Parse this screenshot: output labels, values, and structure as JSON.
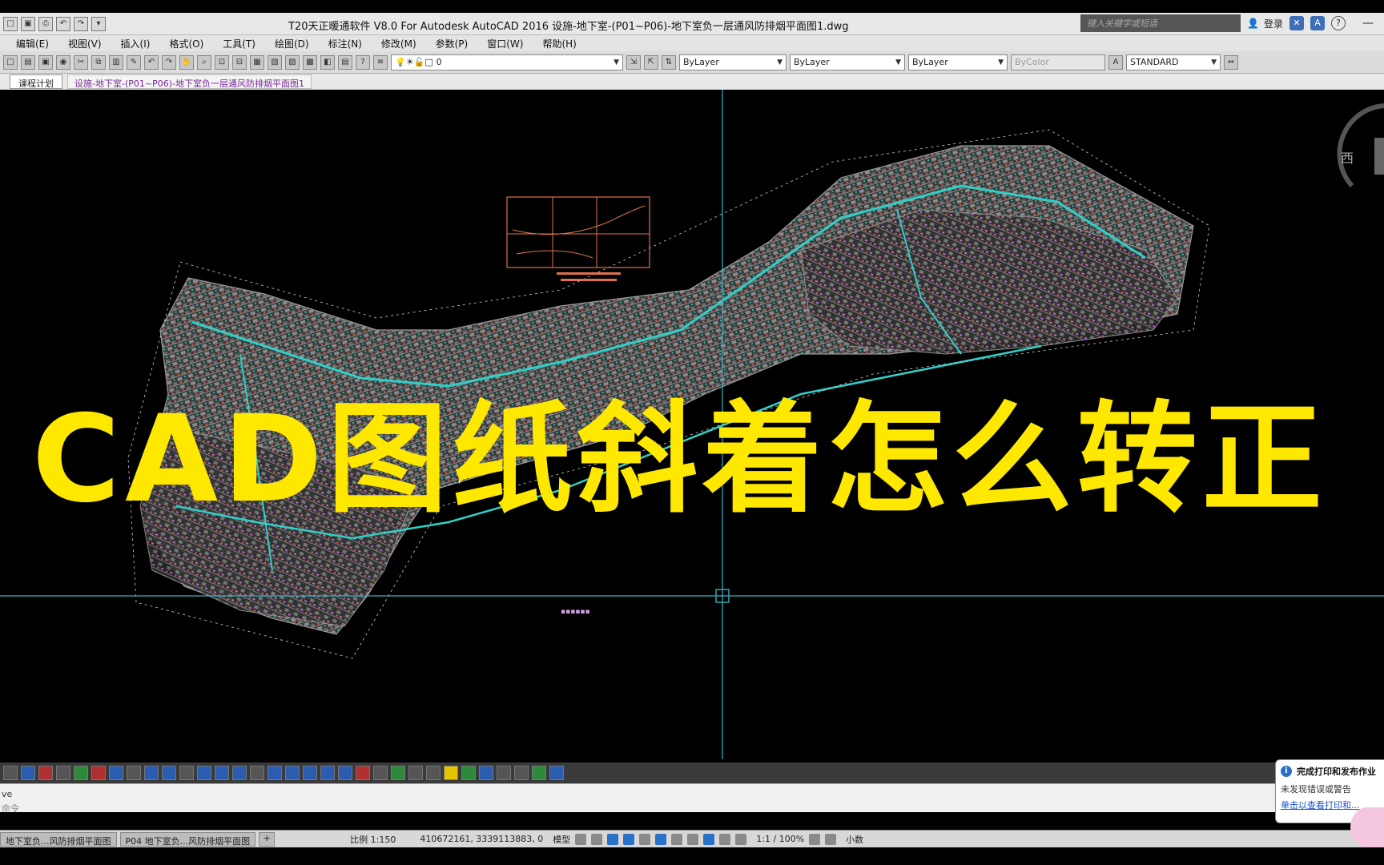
{
  "titlebar": {
    "title": "T20天正暖通软件 V8.0 For Autodesk AutoCAD 2016    设施-地下室-(P01~P06)-地下室负一层通风防排烟平面图1.dwg",
    "search_placeholder": "键入关键字或短语",
    "login_label": "登录"
  },
  "menu": [
    "编辑(E)",
    "视图(V)",
    "插入(I)",
    "格式(O)",
    "工具(T)",
    "绘图(D)",
    "标注(N)",
    "修改(M)",
    "参数(P)",
    "窗口(W)",
    "帮助(H)"
  ],
  "toolbar": {
    "layer": "0",
    "color": "ByLayer",
    "linetype": "ByLayer",
    "lineweight": "ByLayer",
    "plotstyle": "ByColor",
    "textstyle": "STANDARD"
  },
  "tabs": {
    "doc_tab": "课程计划",
    "file_tab": "设施-地下室-(P01~P06)-地下室负一层通风防排烟平面图1"
  },
  "canvas": {
    "overlay_text": "CAD图纸斜着怎么转正",
    "compass": "西"
  },
  "command": {
    "history": "ve",
    "prompt": "命令"
  },
  "status": {
    "layout_tabs": [
      "地下室负...风防排烟平面图",
      "P04 地下室负...风防排烟平面图"
    ],
    "add_tab": "+",
    "scale": "比例 1:150",
    "coords": "410672161, 3339113883, 0",
    "model": "模型",
    "anno_scale": "1:1 / 100%",
    "units": "小数"
  },
  "notification": {
    "title": "完成打印和发布作业",
    "line": "未发现错误或警告",
    "link": "单击以查看打印和..."
  },
  "colors": {
    "overlay": "#ffe800",
    "crosshair": "#3ab0c0",
    "canvas": "#000000"
  }
}
